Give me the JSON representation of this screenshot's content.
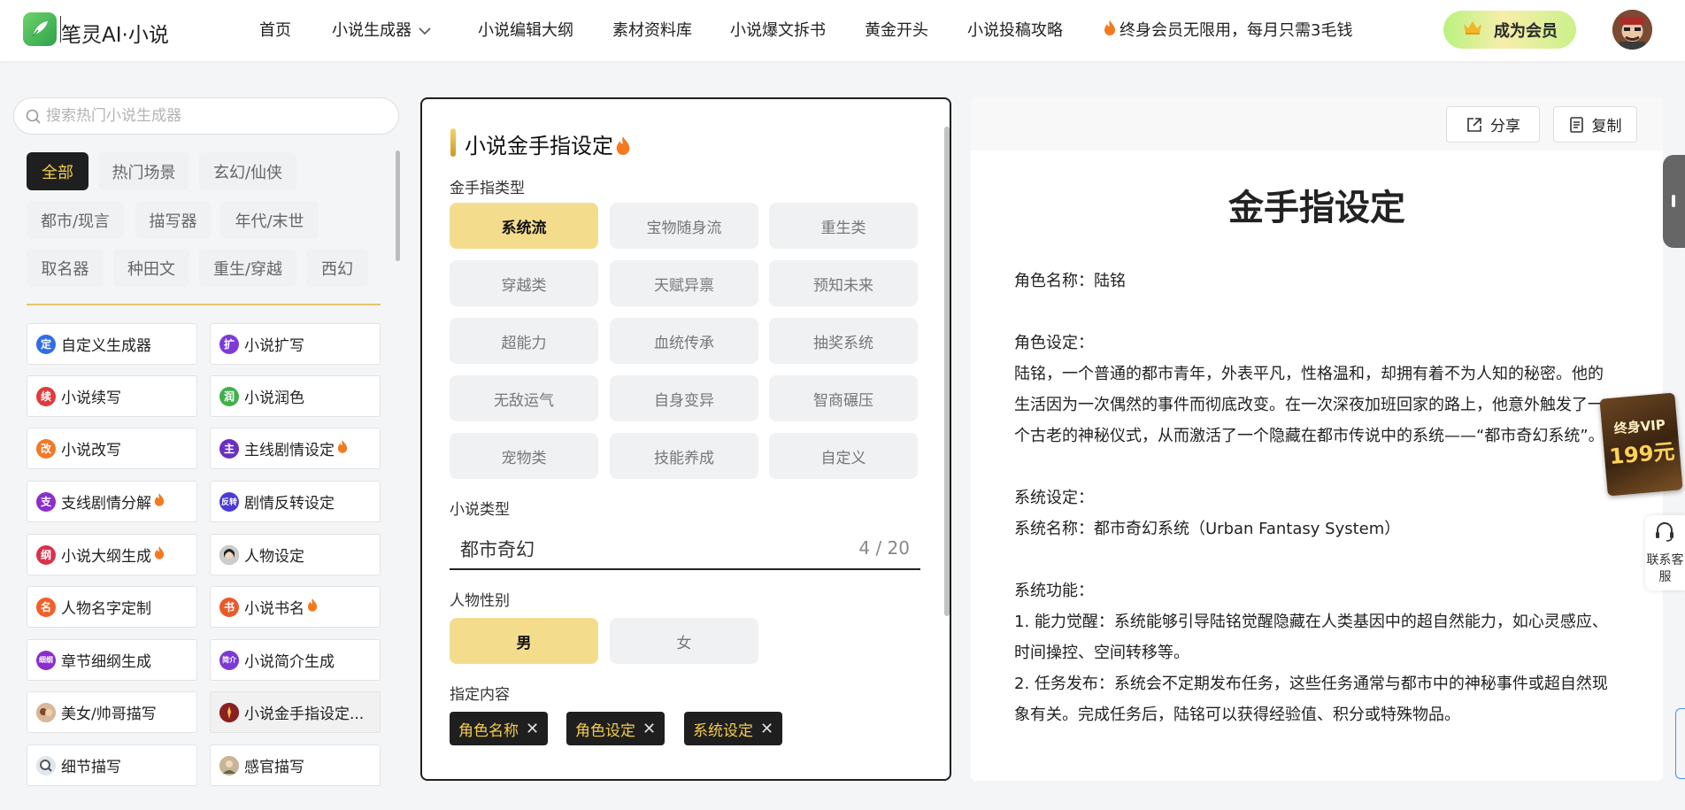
{
  "header": {
    "brand": "笔灵AI·小说",
    "nav": [
      {
        "label": "首页"
      },
      {
        "label": "小说生成器"
      },
      {
        "label": "小说编辑大纲"
      },
      {
        "label": "素材资料库"
      },
      {
        "label": "小说爆文拆书"
      },
      {
        "label": "黄金开头"
      },
      {
        "label": "小说投稿攻略"
      },
      {
        "label": "终身会员无限用，每月只需3毛钱"
      }
    ],
    "vip_button": "成为会员"
  },
  "sidebar": {
    "search_placeholder": "搜索热门小说生成器",
    "categories": [
      "全部",
      "热门场景",
      "玄幻/仙侠",
      "都市/现言",
      "描写器",
      "年代/末世",
      "取名器",
      "种田文",
      "重生/穿越",
      "西幻"
    ],
    "tools": [
      {
        "label": "自定义生成器",
        "icon": "定"
      },
      {
        "label": "小说扩写",
        "icon": "扩"
      },
      {
        "label": "小说续写",
        "icon": "续"
      },
      {
        "label": "小说润色",
        "icon": "润"
      },
      {
        "label": "小说改写",
        "icon": "改"
      },
      {
        "label": "主线剧情设定",
        "icon": "主"
      },
      {
        "label": "支线剧情分解",
        "icon": "支"
      },
      {
        "label": "剧情反转设定",
        "icon": "反转"
      },
      {
        "label": "小说大纲生成",
        "icon": "纲"
      },
      {
        "label": "人物设定",
        "icon": ""
      },
      {
        "label": "人物名字定制",
        "icon": "名"
      },
      {
        "label": "小说书名",
        "icon": "书"
      },
      {
        "label": "章节细纲生成",
        "icon": "细纲"
      },
      {
        "label": "小说简介生成",
        "icon": "简介"
      },
      {
        "label": "美女/帅哥描写",
        "icon": ""
      },
      {
        "label": "小说金手指设定...",
        "icon": ""
      },
      {
        "label": "细节描写",
        "icon": ""
      },
      {
        "label": "感官描写",
        "icon": ""
      }
    ]
  },
  "form": {
    "title": "小说金手指设定",
    "type_label": "金手指类型",
    "types": [
      "系统流",
      "宝物随身流",
      "重生类",
      "穿越类",
      "天赋异禀",
      "预知未来",
      "超能力",
      "血统传承",
      "抽奖系统",
      "无敌运气",
      "自身变异",
      "智商碾压",
      "宠物类",
      "技能养成",
      "自定义"
    ],
    "selected_type": "系统流",
    "novel_type_label": "小说类型",
    "novel_type_value": "都市奇幻",
    "novel_type_count": "4 / 20",
    "gender_label": "人物性别",
    "genders": [
      "男",
      "女"
    ],
    "content_label": "指定内容",
    "content_tags": [
      "角色名称",
      "角色设定",
      "系统设定"
    ]
  },
  "result": {
    "share": "分享",
    "copy": "复制",
    "title": "金手指设定",
    "p1": "角色名称：陆铭",
    "p2": "角色设定：",
    "p3": "陆铭，一个普通的都市青年，外表平凡，性格温和，却拥有着不为人知的秘密。他的生活因为一次偶然的事件而彻底改变。在一次深夜加班回家的路上，他意外触发了一个古老的神秘仪式，从而激活了一个隐藏在都市传说中的系统——“都市奇幻系统”。",
    "p4": "系统设定：",
    "p5": "系统名称：都市奇幻系统（Urban Fantasy System）",
    "p6": "系统功能：",
    "p7": "1. 能力觉醒：系统能够引导陆铭觉醒隐藏在人类基因中的超自然能力，如心灵感应、时间操控、空间转移等。",
    "p8": "2. 任务发布：系统会不定期发布任务，这些任务通常与都市中的神秘事件或超自然现象有关。完成任务后，陆铭可以获得经验值、积分或特殊物品。"
  },
  "floating": {
    "vip_line1": "终身VIP",
    "vip_line2": "199元",
    "service": "联系客服"
  }
}
